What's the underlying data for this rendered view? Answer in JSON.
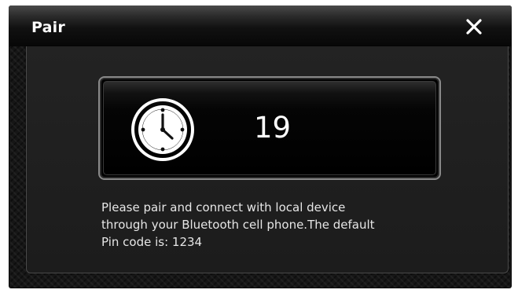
{
  "dialog": {
    "title": "Pair",
    "close_icon": "close-icon"
  },
  "timer": {
    "icon": "clock-icon",
    "countdown": "19"
  },
  "message": {
    "lines": [
      "Please pair and connect with local device",
      "through your Bluetooth cell phone.The default",
      "Pin code is: 1234"
    ]
  }
}
